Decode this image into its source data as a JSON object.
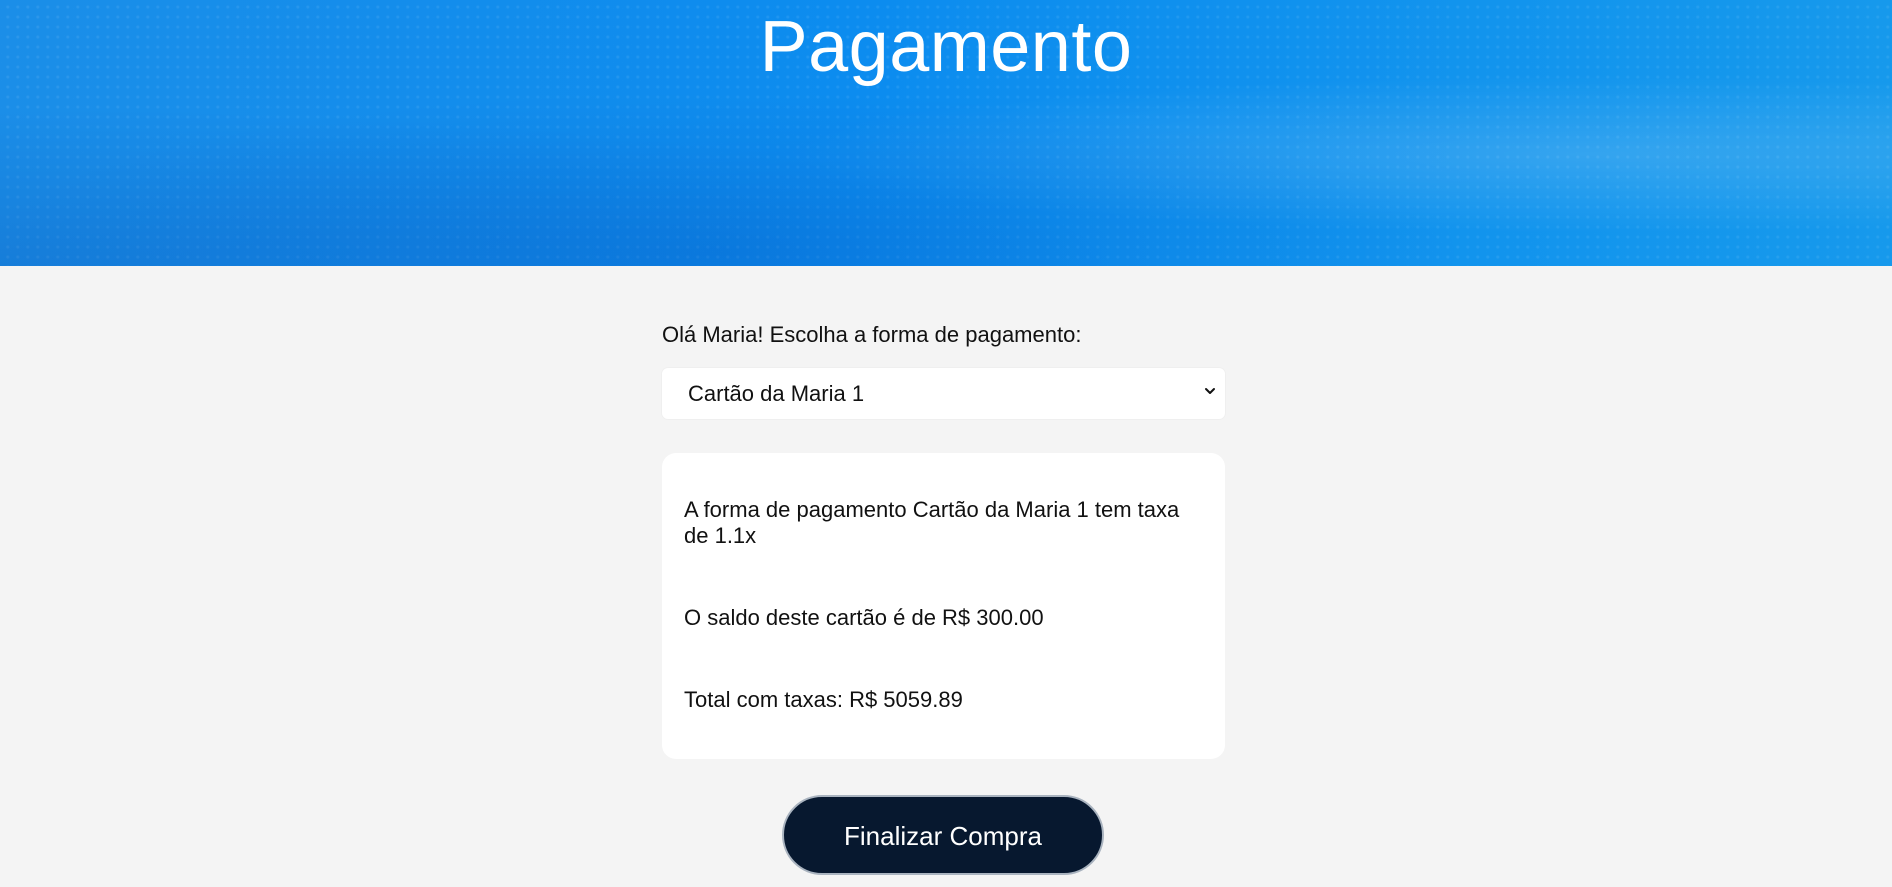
{
  "header": {
    "title": "Pagamento"
  },
  "payment": {
    "prompt": "Olá Maria! Escolha a forma de pagamento:",
    "selected_method": "Cartão da Maria 1",
    "select_icon": "chevron-down-icon",
    "details": {
      "fee_text": "A forma de pagamento Cartão da Maria 1 tem taxa de 1.1x",
      "balance_text": "O saldo deste cartão é de R$ 300.00",
      "total_text": "Total com taxas: R$ 5059.89"
    }
  },
  "actions": {
    "finalize_label": "Finalizar Compra"
  },
  "colors": {
    "header_blue": "#0c8cef",
    "page_background": "#f4f4f4",
    "button_navy": "#07182f"
  }
}
